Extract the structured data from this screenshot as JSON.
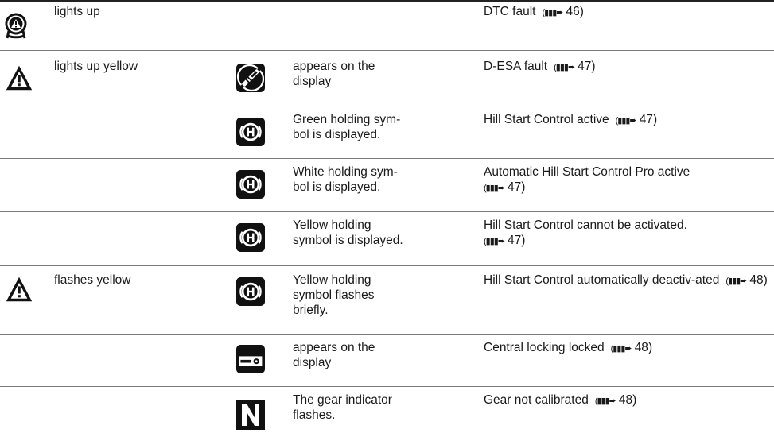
{
  "rows": [
    {
      "c1": "lights up",
      "c2": "",
      "c3": "DTC fault",
      "ref": "46"
    },
    {
      "c1": "lights up yellow",
      "c2": "appears on the display",
      "c3": "D-ESA fault",
      "ref": "47"
    },
    {
      "c1": "",
      "c2": "Green holding sym-bol is displayed.",
      "c3": "Hill Start Control active",
      "ref": "47"
    },
    {
      "c1": "",
      "c2": "White holding sym-bol is displayed.",
      "c3": "Automatic Hill Start Control Pro active",
      "ref": "47"
    },
    {
      "c1": "",
      "c2": "Yellow holding symbol is displayed.",
      "c3": "Hill Start Control cannot be activated.",
      "ref": "47"
    },
    {
      "c1": "flashes yellow",
      "c2": "Yellow holding symbol flashes briefly.",
      "c3": "Hill Start Control automatically deactiv-ated",
      "ref": "48"
    },
    {
      "c1": "",
      "c2": "appears on the display",
      "c3": "Central locking locked",
      "ref": "48"
    },
    {
      "c1": "",
      "c2": "The gear indicator flashes.",
      "c3": "Gear not calibrated",
      "ref": "48"
    }
  ],
  "icons": {
    "r0c1": "dtc-warning-icon",
    "r1c1": "general-warning-triangle-icon",
    "r1c2": "desa-shock-absorber-icon",
    "r2c2": "hill-start-hold-icon",
    "r3c2": "hill-start-hold-icon",
    "r4c2": "hill-start-hold-icon",
    "r5c1": "general-warning-triangle-icon",
    "r5c2": "hill-start-hold-icon",
    "r6c2": "central-locking-key-icon",
    "r7c2": "gear-neutral-n-icon"
  },
  "colors": {
    "text": "#1a1a1a",
    "rule": "#7a7a7a",
    "icon": "#111111"
  }
}
